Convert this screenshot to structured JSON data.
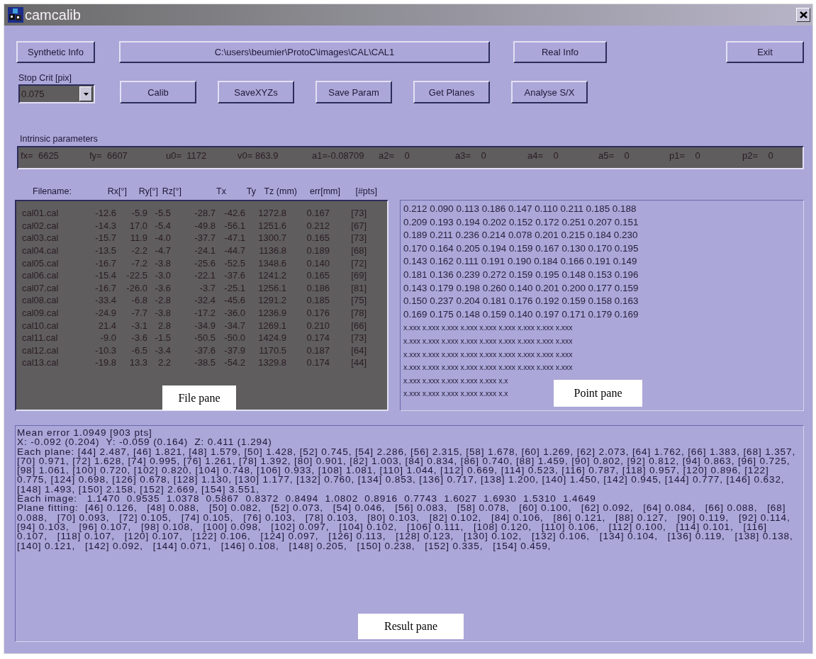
{
  "window": {
    "title": "camcalib"
  },
  "top_buttons": [
    {
      "label": "Synthetic Info",
      "kind": "small"
    },
    {
      "label": "C:\\users\\beumier\\ProtoC\\images\\CAL\\CAL1",
      "kind": "path"
    },
    {
      "label": "Real Info",
      "kind": "medium"
    },
    {
      "label": "Exit",
      "kind": "right"
    }
  ],
  "stop_crit": {
    "label": "Stop Crit [pix]",
    "value": "0.075"
  },
  "action_buttons": [
    "Calib",
    "SaveXYZs",
    "Save Param",
    "Get Planes",
    "Analyse S/X"
  ],
  "intrinsic": {
    "label": "Intrinsic parameters",
    "params": [
      "fx=  6625",
      "fy=  6607",
      "u0=  1172",
      "v0= 863.9",
      "a1=-0.08709",
      "a2=    0",
      "a3=    0",
      "a4=    0",
      "a5=    0",
      "p1=    0",
      "p2=    0"
    ]
  },
  "file_pane": {
    "columns": [
      "Filename:",
      "Rx[°]",
      "Ry[°]",
      "Rz[°]",
      "Tx",
      "Ty",
      "Tz (mm)",
      "err[mm]",
      "[#pts]"
    ],
    "rows": [
      [
        "cal01.cal",
        "-12.6",
        "-5.9",
        "-5.5",
        "-28.7",
        "-42.6",
        "1272.8",
        "0.167",
        "[73]"
      ],
      [
        "cal02.cal",
        "-14.3",
        "17.0",
        "-5.4",
        "-49.8",
        "-56.1",
        "1251.6",
        "0.212",
        "[67]"
      ],
      [
        "cal03.cal",
        "-15.7",
        "11.9",
        "-4.0",
        "-37.7",
        "-47.1",
        "1300.7",
        "0.165",
        "[73]"
      ],
      [
        "cal04.cal",
        "-13.5",
        "-2.2",
        "-4.7",
        "-24.1",
        "-44.7",
        "1136.8",
        "0.189",
        "[68]"
      ],
      [
        "cal05.cal",
        "-16.7",
        "-7.2",
        "-3.8",
        "-25.6",
        "-52.5",
        "1348.6",
        "0.140",
        "[72]"
      ],
      [
        "cal06.cal",
        "-15.4",
        "-22.5",
        "-3.0",
        "-22.1",
        "-37.6",
        "1241.2",
        "0.165",
        "[69]"
      ],
      [
        "cal07.cal",
        "-16.7",
        "-26.0",
        "-3.6",
        "-3.7",
        "-25.1",
        "1256.1",
        "0.186",
        "[81]"
      ],
      [
        "cal08.cal",
        "-33.4",
        "-6.8",
        "-2.8",
        "-32.4",
        "-45.6",
        "1291.2",
        "0.185",
        "[75]"
      ],
      [
        "cal09.cal",
        "-24.9",
        "-7.7",
        "-3.8",
        "-17.2",
        "-36.0",
        "1236.9",
        "0.176",
        "[78]"
      ],
      [
        "cal10.cal",
        "21.4",
        "-3.1",
        "2.8",
        "-34.9",
        "-34.7",
        "1269.1",
        "0.210",
        "[66]"
      ],
      [
        "cal11.cal",
        "-9.0",
        "-3.6",
        "-1.5",
        "-50.5",
        "-50.0",
        "1424.9",
        "0.174",
        "[73]"
      ],
      [
        "cal12.cal",
        "-10.3",
        "-6.5",
        "-3.4",
        "-37.6",
        "-37.9",
        "1170.5",
        "0.187",
        "[64]"
      ],
      [
        "cal13.cal",
        "-19.8",
        "13.3",
        "2.2",
        "-38.5",
        "-54.2",
        "1329.8",
        "0.174",
        "[44]"
      ]
    ],
    "annotation": "File pane"
  },
  "point_pane": {
    "rows": [
      "0.212 0.090 0.113 0.186 0.147 0.110 0.211 0.185 0.188",
      "0.209 0.193 0.194 0.202 0.152 0.172 0.251 0.207 0.151",
      "0.189 0.211 0.236 0.214 0.078 0.201 0.215 0.184 0.230",
      "0.170 0.164 0.205 0.194 0.159 0.167 0.130 0.170 0.195",
      "0.143 0.162 0.111 0.191 0.190 0.184 0.166 0.191 0.149",
      "0.181 0.136 0.239 0.272 0.159 0.195 0.148 0.153 0.196",
      "0.143 0.179 0.198 0.260 0.140 0.201 0.200 0.177 0.159",
      "0.150 0.237 0.204 0.181 0.176 0.192 0.159 0.158 0.163",
      "0.169 0.175 0.148 0.159 0.140 0.197 0.171 0.179 0.169"
    ],
    "placeholder_rows": [
      "x.xxx x.xxx x.xxx x.xxx x.xxx x.xxx x.xxx x.xxx x.xxx",
      "x.xxx x.xxx x.xxx x.xxx x.xxx x.xxx x.xxx x.xxx x.xxx",
      "x.xxx x.xxx x.xxx x.xxx x.xxx x.xxx x.xxx x.xxx x.xxx",
      "x.xxx x.xxx x.xxx x.xxx x.xxx x.xxx x.xxx x.xxx x.xxx",
      "x.xxx x.xxx x.xxx x.xxx x.xxx x.x",
      "x.xxx x.xxx x.xxx x.xxx x.xxx x.x"
    ],
    "annotation": "Point pane"
  },
  "result_pane": {
    "lines": [
      "Mean error 1.0949 [903 pts]",
      "X: -0.092 (0.204)  Y: -0.059 (0.164)  Z: 0.411 (1.294)",
      "Each plane: [44] 2.487, [46] 1.821, [48] 1.579, [50] 1.428, [52] 0.745, [54] 2.286, [56] 2.315, [58] 1.678, [60] 1.269, [62] 2.073, [64] 1.762, [66] 1.383, [68] 1.357,",
      "[70] 0.971, [72] 1.628, [74] 0.995, [76] 1.261, [78] 1.392, [80] 0.901, [82] 1.003, [84] 0.834, [86] 0.740, [88] 1.459, [90] 0.802, [92] 0.812, [94] 0.863, [96] 0.725,",
      "[98] 1.061, [100] 0.720, [102] 0.820, [104] 0.748, [106] 0.933, [108] 1.081, [110] 1.044, [112] 0.669, [114] 0.523, [116] 0.787, [118] 0.957, [120] 0.896, [122]",
      "0.775, [124] 0.698, [126] 0.678, [128] 1.130, [130] 1.177, [132] 0.760, [134] 0.853, [136] 0.717, [138] 1.200, [140] 1.450, [142] 0.945, [144] 0.777, [146] 0.632,",
      "[148] 1.493, [150] 2.158, [152] 2.669, [154] 3.551,",
      "Each image:   1.1470  0.9535  1.0378  0.5867  0.8372  0.8494  1.0802  0.8916  0.7743  1.6027  1.6930  1.5310  1.4649",
      "Plane fitting:  [46] 0.126,   [48] 0.088,   [50] 0.082,   [52] 0.073,   [54] 0.046,   [56] 0.083,   [58] 0.078,   [60] 0.100,   [62] 0.092,   [64] 0.084,   [66] 0.088,   [68]",
      "0.088,   [70] 0.093,   [72] 0.105,   [74] 0.105,   [76] 0.103,   [78] 0.103,   [80] 0.103,   [82] 0.102,   [84] 0.106,   [86] 0.121,   [88] 0.127,   [90] 0.119,   [92] 0.114,",
      "[94] 0.103,   [96] 0.107,   [98] 0.108,   [100] 0.098,   [102] 0.097,   [104] 0.102,   [106] 0.111,   [108] 0.120,   [110] 0.106,   [112] 0.100,   [114] 0.101,   [116]",
      "0.107,   [118] 0.107,   [120] 0.107,   [122] 0.106,   [124] 0.097,   [126] 0.113,   [128] 0.123,   [130] 0.102,   [132] 0.106,   [134] 0.104,   [136] 0.119,   [138] 0.138,",
      "[140] 0.121,   [142] 0.092,   [144] 0.071,   [146] 0.108,   [148] 0.205,   [150] 0.238,   [152] 0.335,   [154] 0.459,"
    ],
    "annotation": "Result pane"
  }
}
